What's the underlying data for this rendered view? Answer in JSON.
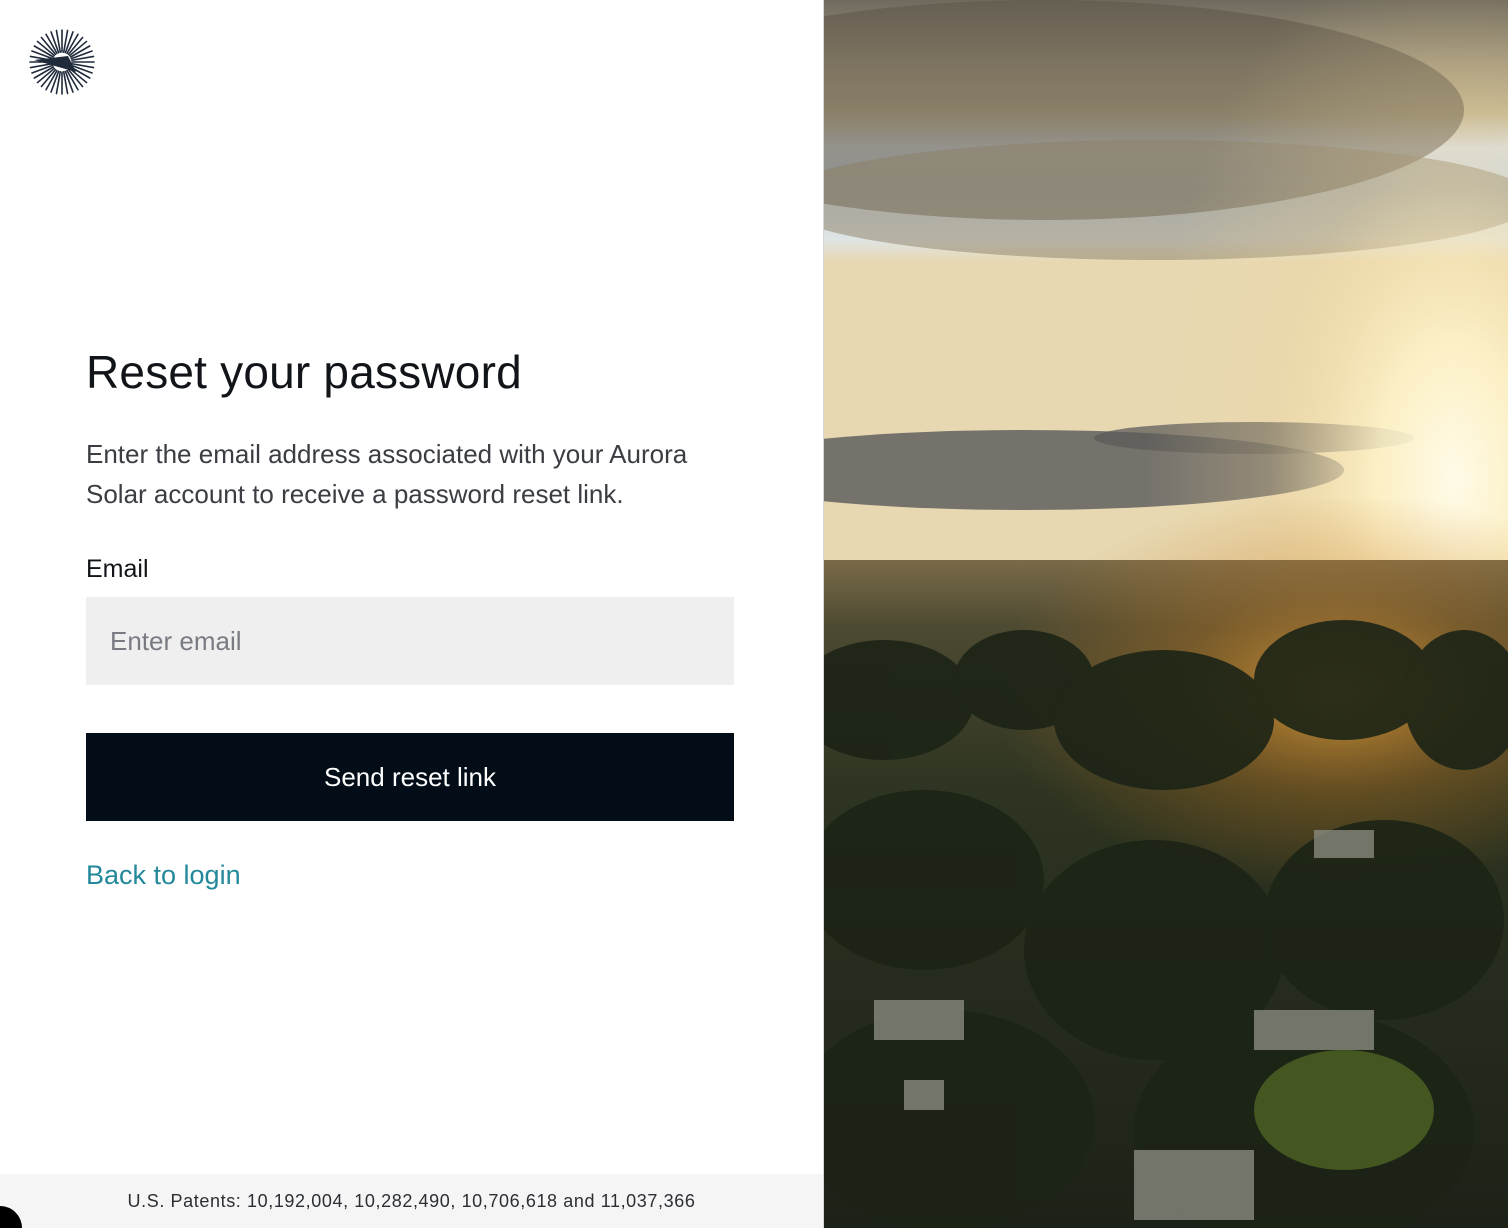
{
  "brand": {
    "logo_icon": "aurora-sunburst-icon",
    "accent_color": "#23889a",
    "button_color": "#020d18"
  },
  "form": {
    "title": "Reset your password",
    "description": "Enter the email address associated with your Aurora Solar account to receive a password reset link.",
    "email_label": "Email",
    "email_placeholder": "Enter email",
    "email_value": "",
    "submit_label": "Send reset link",
    "back_link": "Back to login"
  },
  "footer": {
    "patents": "U.S. Patents: 10,192,004, 10,282,490, 10,706,618 and 11,037,366"
  }
}
